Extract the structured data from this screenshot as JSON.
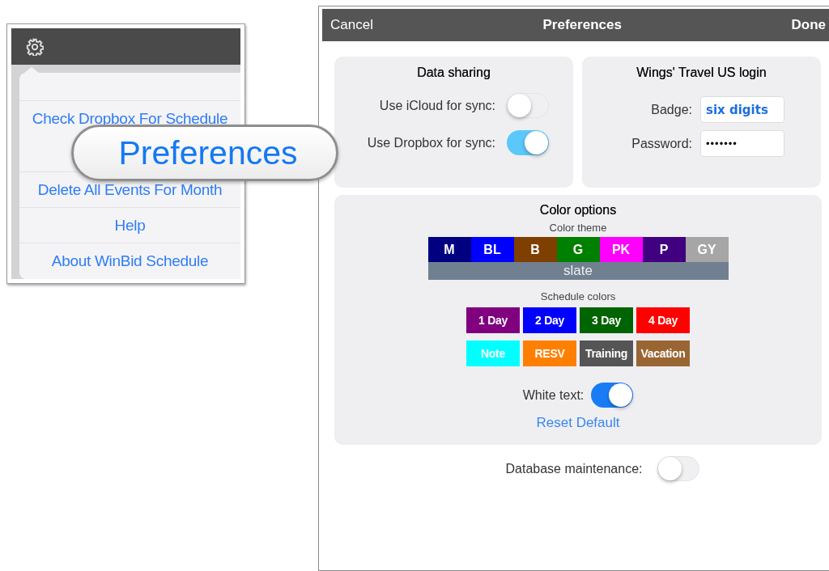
{
  "menu_screenshot": {
    "items": [
      {
        "label": "Check Dropbox For Schedule"
      },
      {
        "label": "Delete All Events For Month"
      },
      {
        "label": "Help"
      },
      {
        "label": "About WinBid Schedule"
      }
    ]
  },
  "callout": {
    "text": "Preferences"
  },
  "preferences": {
    "nav": {
      "cancel": "Cancel",
      "title": "Preferences",
      "done": "Done"
    },
    "data_sharing": {
      "title": "Data sharing",
      "toggles": [
        {
          "label": "Use iCloud for sync:",
          "on": false
        },
        {
          "label": "Use Dropbox for sync:",
          "on": true
        }
      ]
    },
    "login": {
      "title": "Wings' Travel US login",
      "fields": [
        {
          "label": "Badge:",
          "value": "six digits",
          "kind": "text"
        },
        {
          "label": "Password:",
          "value": "•••••••",
          "kind": "password"
        }
      ]
    },
    "color_options": {
      "title": "Color options",
      "theme_heading": "Color theme",
      "themes": [
        {
          "label": "M",
          "color": "#000080"
        },
        {
          "label": "BL",
          "color": "#0000ff"
        },
        {
          "label": "B",
          "color": "#7f3f00"
        },
        {
          "label": "G",
          "color": "#008000"
        },
        {
          "label": "PK",
          "color": "#ff00ff"
        },
        {
          "label": "P",
          "color": "#400080"
        },
        {
          "label": "GY",
          "color": "#a6a6a6"
        }
      ],
      "current_theme": {
        "label": "slate",
        "color": "#708090"
      },
      "schedule_heading": "Schedule colors",
      "schedule_colors": [
        {
          "label": "1 Day",
          "color": "#800080"
        },
        {
          "label": "2 Day",
          "color": "#0000ff"
        },
        {
          "label": "3 Day",
          "color": "#006400"
        },
        {
          "label": "4 Day",
          "color": "#ff0000"
        },
        {
          "label": "Note",
          "color": "#00ffff"
        },
        {
          "label": "RESV",
          "color": "#ff8000"
        },
        {
          "label": "Training",
          "color": "#555555"
        },
        {
          "label": "Vacation",
          "color": "#996633"
        }
      ],
      "white_text": {
        "label": "White text:",
        "on": true
      },
      "reset": "Reset Default"
    },
    "database_maintenance": {
      "label": "Database maintenance:",
      "on": false
    }
  }
}
